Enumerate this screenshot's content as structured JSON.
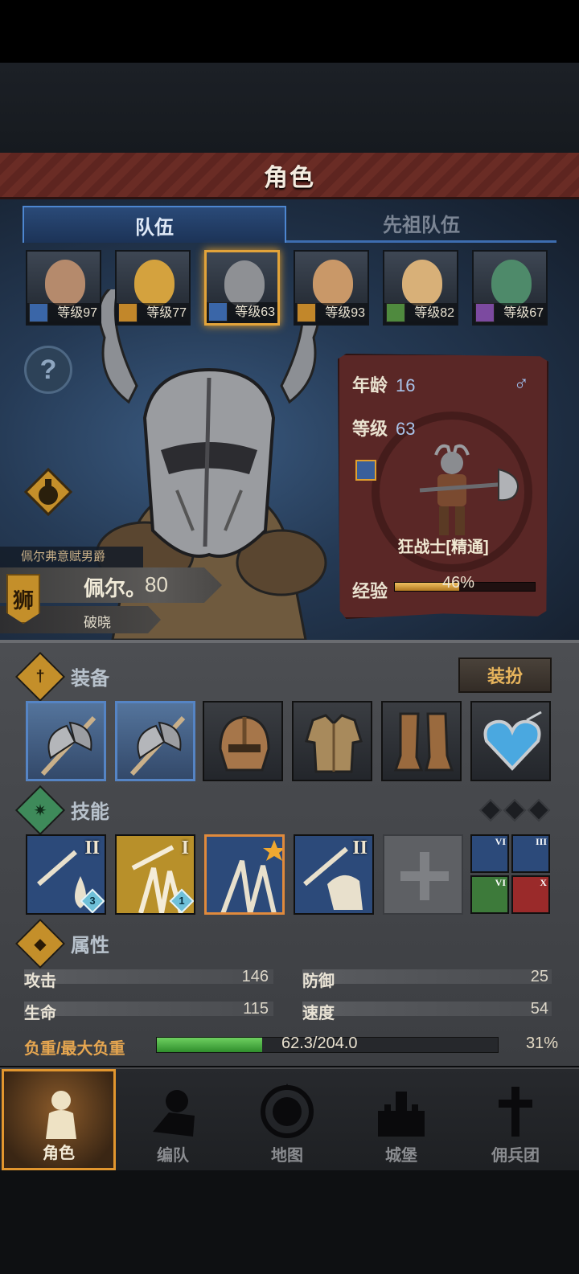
{
  "screen": {
    "title": "角色"
  },
  "tabs": [
    {
      "label": "队伍",
      "active": true
    },
    {
      "label": "先祖队伍",
      "active": false
    }
  ],
  "party": [
    {
      "level": "等级97",
      "class_icon": "sword-class-icon",
      "class_color": "#3a66a8",
      "selected": false
    },
    {
      "level": "等级77",
      "class_icon": "shield-class-icon",
      "class_color": "#c2872a",
      "selected": false
    },
    {
      "level": "等级63",
      "class_icon": "sword-class-icon",
      "class_color": "#3a66a8",
      "selected": true
    },
    {
      "level": "等级93",
      "class_icon": "shield-class-icon",
      "class_color": "#c2872a",
      "selected": false
    },
    {
      "level": "等级82",
      "class_icon": "bow-class-icon",
      "class_color": "#4f8a3e",
      "selected": false
    },
    {
      "level": "等级67",
      "class_icon": "staff-class-icon",
      "class_color": "#7c4aa0",
      "selected": false
    }
  ],
  "hero": {
    "title_tag": "佩尔弗意赋男爵",
    "name": "佩尔。",
    "name_number": "80",
    "subtitle": "破晓"
  },
  "card": {
    "age_label": "年龄",
    "age": "16",
    "gender_symbol": "♂",
    "level_label": "等级",
    "level": "63",
    "role": "狂战士[精通]",
    "exp_label": "经验",
    "exp_text": "46%",
    "exp_fraction": 0.46
  },
  "equipment": {
    "label": "装备",
    "dress_button": "装扮",
    "slots": [
      {
        "name": "axe-slot-1",
        "icon": "battle-axe-icon",
        "highlight": true
      },
      {
        "name": "axe-slot-2",
        "icon": "battle-axe-icon",
        "highlight": true
      },
      {
        "name": "helmet-slot",
        "icon": "helmet-icon",
        "highlight": false
      },
      {
        "name": "armor-slot",
        "icon": "leather-armor-icon",
        "highlight": false
      },
      {
        "name": "boots-slot",
        "icon": "boots-icon",
        "highlight": false
      },
      {
        "name": "amulet-slot",
        "icon": "heart-amulet-icon",
        "highlight": false
      }
    ]
  },
  "skills": {
    "label": "技能",
    "items": [
      {
        "roman": "II",
        "badge": "3",
        "bg": "#2c4a7a"
      },
      {
        "roman": "I",
        "badge": "1",
        "bg": "#b8902a"
      },
      {
        "roman": "",
        "badge": "",
        "bg": "#2c4a7a",
        "star": true
      },
      {
        "roman": "II",
        "badge": "",
        "bg": "#2c4a7a"
      }
    ],
    "mini": [
      {
        "roman": "VI",
        "bg": "#2c4a7a"
      },
      {
        "roman": "III",
        "bg": "#2c4a7a"
      },
      {
        "roman": "VI",
        "bg": "#3d7a3a"
      },
      {
        "roman": "X",
        "bg": "#9a2a2a"
      }
    ]
  },
  "attributes": {
    "label": "属性",
    "attack_label": "攻击",
    "attack": "146",
    "defense_label": "防御",
    "defense": "25",
    "hp_label": "生命",
    "hp": "115",
    "speed_label": "速度",
    "speed": "54",
    "load_label": "负重/最大负重",
    "load_value": "62.3/204.0",
    "load_percent": "31%",
    "load_fraction": 0.31
  },
  "nav": [
    {
      "label": "角色",
      "selected": true,
      "icon": "knight-icon"
    },
    {
      "label": "编队",
      "selected": false,
      "icon": "formation-icon"
    },
    {
      "label": "地图",
      "selected": false,
      "icon": "compass-map-icon"
    },
    {
      "label": "城堡",
      "selected": false,
      "icon": "castle-icon"
    },
    {
      "label": "佣兵团",
      "selected": false,
      "icon": "mercenary-icon"
    }
  ],
  "colors": {
    "accent_gold": "#e2a33a",
    "card_red": "#5a2726",
    "tab_blue": "#4d86d0",
    "load_green": "#4fb044"
  }
}
